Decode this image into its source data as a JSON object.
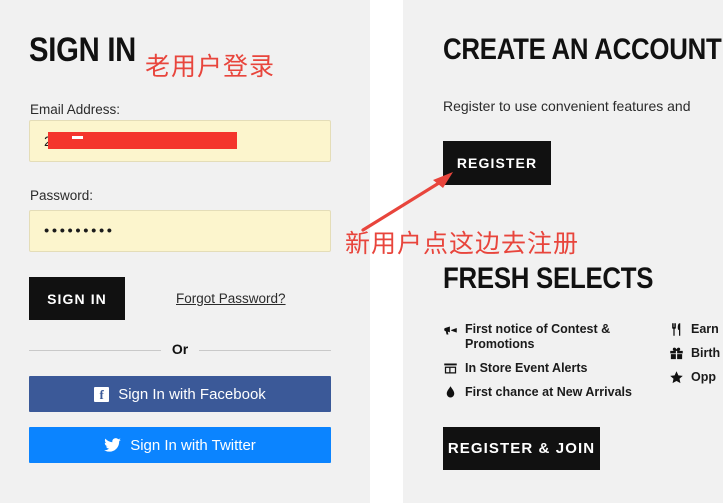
{
  "theme": {
    "panel_bg": "#f1f1f1",
    "page_bg": "#ffffff",
    "button_black": "#111111",
    "input_autofill_bg": "#fcf5cd",
    "input_border": "#e4ddb8",
    "facebook_blue": "#3b5998",
    "twitter_blue": "#0b84ff",
    "annotation_red": "#e8453c",
    "redaction_red": "#f4352c"
  },
  "signin": {
    "title": "SIGN IN",
    "email_label": "Email Address:",
    "email_value": "2",
    "email_redacted": true,
    "password_label": "Password:",
    "password_value": "•••••••••",
    "password_dot_count": 9,
    "submit_label": "SIGN IN",
    "forgot_label": "Forgot Password?",
    "or_label": "Or",
    "facebook_label": "Sign In with Facebook",
    "facebook_icon": "facebook-icon",
    "twitter_label": "Sign In with Twitter",
    "twitter_icon": "twitter-icon"
  },
  "create_account": {
    "title": "CREATE AN ACCOUNT",
    "subtitle": "Register to use convenient features and",
    "register_label": "REGISTER"
  },
  "fresh_selects": {
    "title": "FRESH SELECTS",
    "perks_left": [
      {
        "icon": "bullhorn-icon",
        "text": "First notice of Contest & Promotions"
      },
      {
        "icon": "store-icon",
        "text": "In Store Event Alerts"
      },
      {
        "icon": "fire-icon",
        "text": "First chance at New Arrivals"
      }
    ],
    "perks_right": [
      {
        "icon": "utensils-icon",
        "text": "Earn"
      },
      {
        "icon": "gift-icon",
        "text": "Birth"
      },
      {
        "icon": "star-icon",
        "text": "Opp"
      }
    ],
    "register_join_label": "REGISTER & JOIN"
  },
  "annotations": {
    "note_signin": "老用户登录",
    "note_register": "新用户点这边去注册",
    "arrow": "red-arrow-pointing-to-register-button"
  }
}
